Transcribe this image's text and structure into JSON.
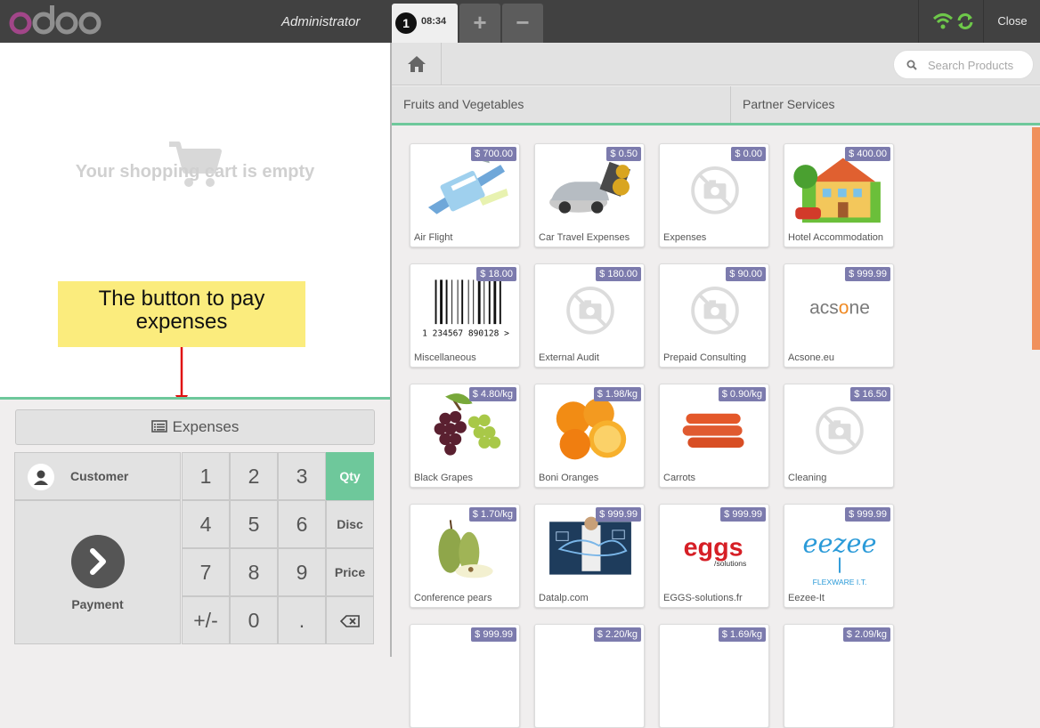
{
  "header": {
    "logo_text": "odoo",
    "user": "Administrator",
    "order_number": "1",
    "order_time": "08:34",
    "add_order_label": "+",
    "remove_order_label": "−",
    "close_label": "Close"
  },
  "cart": {
    "empty_text": "Your shopping cart is empty"
  },
  "annotation": {
    "text": "The button to pay expenses"
  },
  "controls": {
    "expenses_label": "Expenses",
    "customer_label": "Customer",
    "payment_label": "Payment",
    "keys": [
      "1",
      "2",
      "3",
      "4",
      "5",
      "6",
      "7",
      "8",
      "9",
      "+/-",
      "0",
      "."
    ],
    "modes": [
      "Qty",
      "Disc",
      "Price"
    ],
    "selected_mode": "Qty"
  },
  "search": {
    "placeholder": "Search Products"
  },
  "categories": [
    "Fruits and Vegetables",
    "Partner Services"
  ],
  "products": [
    {
      "name": "Air Flight",
      "price": "$ 700.00",
      "image": "air-flight"
    },
    {
      "name": "Car Travel Expenses",
      "price": "$ 0.50",
      "image": "car"
    },
    {
      "name": "Expenses",
      "price": "$ 0.00",
      "image": "no-image"
    },
    {
      "name": "Hotel Accommodation",
      "price": "$ 400.00",
      "image": "house"
    },
    {
      "name": "Miscellaneous",
      "price": "$ 18.00",
      "image": "barcode"
    },
    {
      "name": "External Audit",
      "price": "$ 180.00",
      "image": "no-image"
    },
    {
      "name": "Prepaid Consulting",
      "price": "$ 90.00",
      "image": "no-image"
    },
    {
      "name": "Acsone.eu",
      "price": "$ 999.99",
      "image": "acsone-logo"
    },
    {
      "name": "Black Grapes",
      "price": "$ 4.80/kg",
      "image": "grapes"
    },
    {
      "name": "Boni Oranges",
      "price": "$ 1.98/kg",
      "image": "oranges"
    },
    {
      "name": "Carrots",
      "price": "$ 0.90/kg",
      "image": "carrots"
    },
    {
      "name": "Cleaning",
      "price": "$ 16.50",
      "image": "no-image"
    },
    {
      "name": "Conference pears",
      "price": "$ 1.70/kg",
      "image": "pears"
    },
    {
      "name": "Datalp.com",
      "price": "$ 999.99",
      "image": "datalp"
    },
    {
      "name": "EGGS-solutions.fr",
      "price": "$ 999.99",
      "image": "eggs-logo"
    },
    {
      "name": "Eezee-It",
      "price": "$ 999.99",
      "image": "eezee-logo"
    },
    {
      "name": "",
      "price": "$ 999.99",
      "image": "partial"
    },
    {
      "name": "",
      "price": "$ 2.20/kg",
      "image": "partial"
    },
    {
      "name": "",
      "price": "$ 1.69/kg",
      "image": "partial"
    },
    {
      "name": "",
      "price": "$ 2.09/kg",
      "image": "partial"
    }
  ],
  "logo_texts": {
    "acsone": "acsone",
    "eggs": "eggs",
    "eggs_sub": "/solutions",
    "eezee": "eezee",
    "eezee_sub": "FLEXWARE I.T.",
    "barcode_digits": "1 234567 890128 >"
  },
  "colors": {
    "accent": "#6ec89b",
    "price_badge": "#7c7bad",
    "topbar": "#414141",
    "annotation": "#fbec7d",
    "scroll": "#f0905c"
  }
}
